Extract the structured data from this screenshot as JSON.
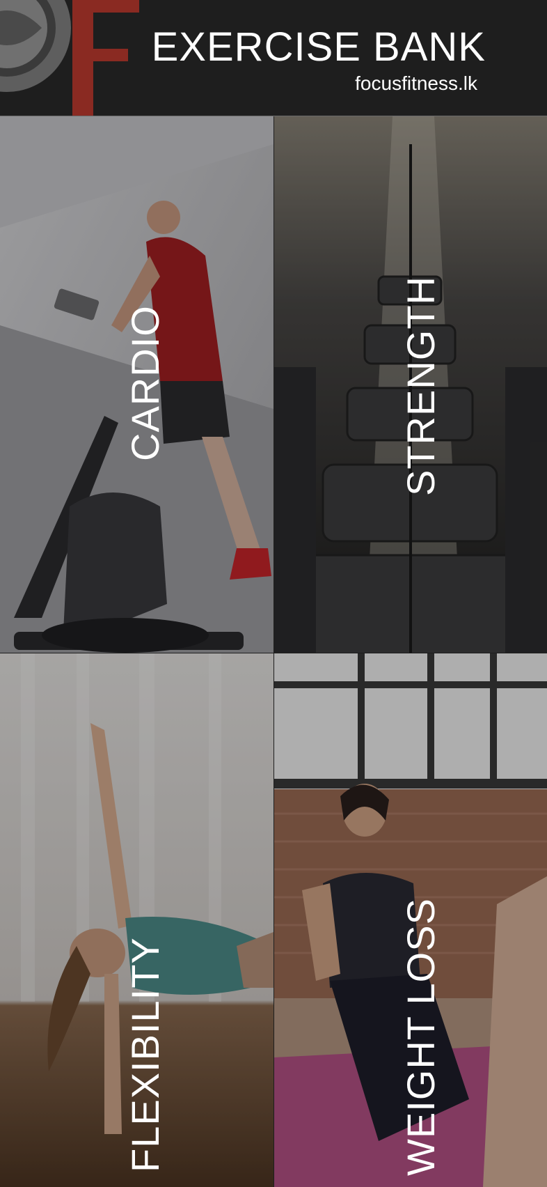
{
  "header": {
    "title": "EXERCISE BANK",
    "website": "focusfitness.lk",
    "logo_letter": "F"
  },
  "categories": [
    {
      "label": "CARDIO",
      "image": "man-on-elliptical-trainer"
    },
    {
      "label": "STRENGTH",
      "image": "rows-of-dumbbells"
    },
    {
      "label": "FLEXIBILITY",
      "image": "woman-yoga-side-plank"
    },
    {
      "label": "WEIGHT LOSS",
      "image": "woman-exercising-on-mat"
    }
  ],
  "colors": {
    "background": "#1e1e1e",
    "logo_red": "#8a2a22",
    "logo_grey": "#6b6b6b",
    "text": "#ffffff"
  }
}
